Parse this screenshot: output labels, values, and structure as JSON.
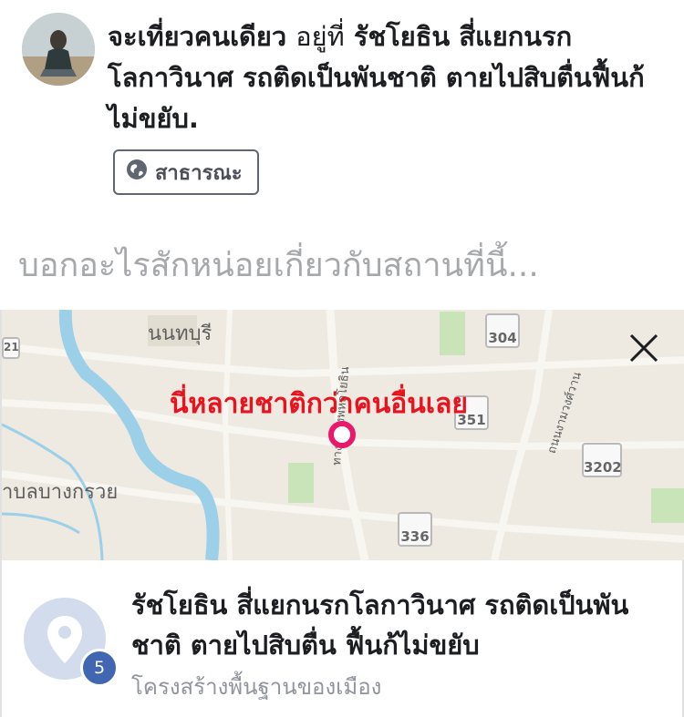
{
  "post": {
    "status_prefix": "จะเที่ยวคนเดียว",
    "status_connector": "อยู่ที่",
    "location": "รัชโยธิน สี่แยกนรกโลกาวินาศ รถติดเป็นพันชาติ ตายไปสิบตื่นฟื้นก้ไม่ขยับ."
  },
  "privacy": {
    "label": "สาธารณะ",
    "icon": "globe-icon"
  },
  "prompt": {
    "placeholder": "บอกอะไรสักหน่อยเกี่ยวกับสถานที่นี้..."
  },
  "map": {
    "labels": {
      "nonthaburi": "นนทบุรี",
      "bang_kruai": "าบลบางกรวย",
      "road_phahonyothin": "ทางหลวงพหลโยธิน",
      "road_north": "ถนนงามวงศ์วาน"
    },
    "overlay_text": "นี่หลายชาติกว่าคนอื่นเลย",
    "route_shields": [
      "304",
      "351",
      "3202",
      "336",
      "21"
    ],
    "pin_color": "#e8196b",
    "overlay_color": "#e8131e"
  },
  "place": {
    "name": "รัชโยธิน สี่แยกนรกโลกาวินาศ รถติดเป็นพันชาติ ตายไปสิบตื่น ฟื้นก้ไม่ขยับ",
    "category": "โครงสร้างพื้นฐานของเมือง",
    "checkin_count": "5",
    "icon": "location-pin-icon"
  },
  "colors": {
    "badge": "#4267b2",
    "text": "#1c1e21",
    "muted": "#90949c"
  }
}
